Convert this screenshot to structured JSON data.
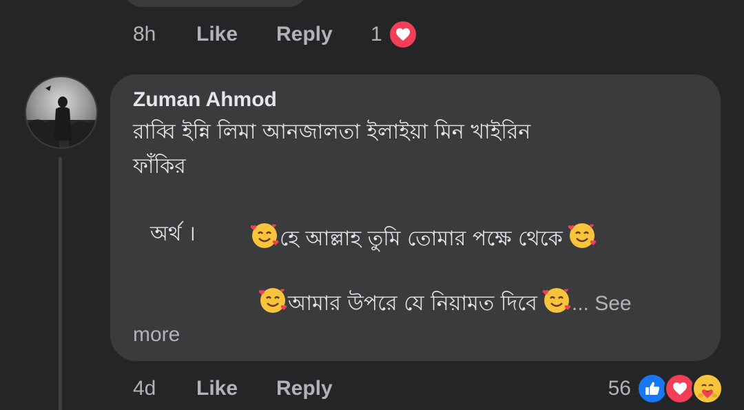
{
  "previous_comment": {
    "time": "8h",
    "like_label": "Like",
    "reply_label": "Reply",
    "reaction_count": "1",
    "reactions": [
      "heart-icon"
    ]
  },
  "comment": {
    "author": "Zuman Ahmod",
    "lines": [
      "রাব্বি  ইন্নি  লিমা আনজালতা  ইলাইয়া মিন খাইরিন",
      "ফাঁকির",
      "অর্থ    ।",
      "হে আল্লাহ তুমি তোমার পক্ষে থেকে",
      "আমার উপরে যে নিয়ামত দিবে",
      "... See",
      "more"
    ],
    "time": "4d",
    "like_label": "Like",
    "reply_label": "Reply",
    "reaction_count": "56",
    "reactions": [
      "like-icon",
      "love-icon",
      "care-icon"
    ]
  },
  "colors": {
    "background": "#242526",
    "bubble": "#3a3b3c",
    "secondary_text": "#b0b3b8",
    "primary_text": "#e4e6eb",
    "like_blue": "#1877f2",
    "love_red": "#f33e58",
    "care_yellow": "#f7c43b"
  }
}
